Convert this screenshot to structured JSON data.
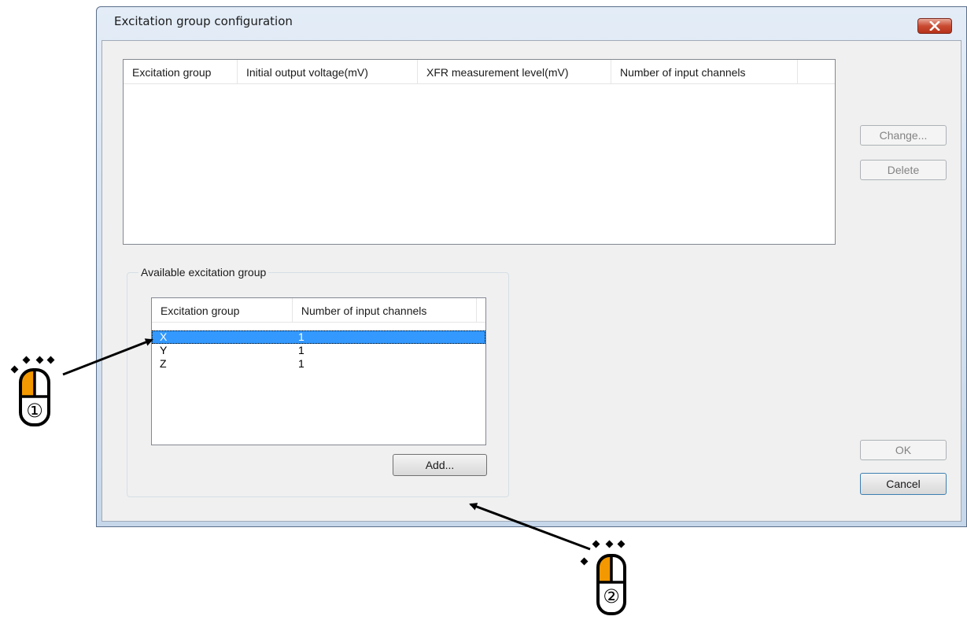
{
  "dialog": {
    "title": "Excitation group configuration"
  },
  "group_list": {
    "columns": [
      "Excitation group",
      "Initial output voltage(mV)",
      "XFR measurement level(mV)",
      "Number of input channels"
    ],
    "rows": []
  },
  "side_buttons": {
    "change_label": "Change...",
    "delete_label": "Delete"
  },
  "available": {
    "group_label": "Available excitation group",
    "columns": [
      "Excitation group",
      "Number of input channels"
    ],
    "rows": [
      {
        "group": "X",
        "channels": "1",
        "selected": true
      },
      {
        "group": "Y",
        "channels": "1",
        "selected": false
      },
      {
        "group": "Z",
        "channels": "1",
        "selected": false
      }
    ],
    "add_label": "Add..."
  },
  "footer": {
    "ok_label": "OK",
    "cancel_label": "Cancel"
  },
  "annotations": {
    "step1_label": "①",
    "step2_label": "②",
    "mouse_highlight_color": "#f39800",
    "arrow_color": "#000000"
  }
}
